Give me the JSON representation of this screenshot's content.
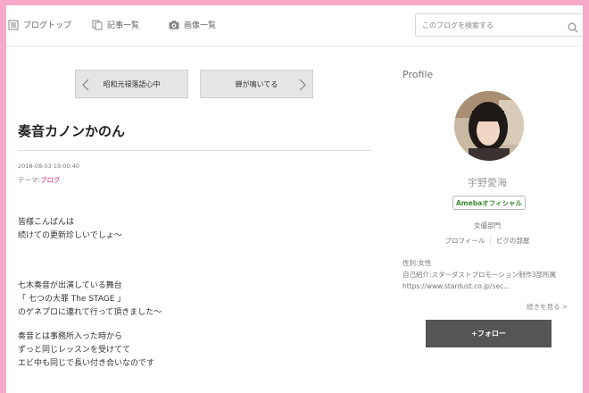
{
  "nav": {
    "items": [
      {
        "label": "ブログトップ",
        "icon": "list-icon"
      },
      {
        "label": "記事一覧",
        "icon": "copy-icon"
      },
      {
        "label": "画像一覧",
        "icon": "camera-icon"
      }
    ],
    "search_placeholder": "このブログを検索する"
  },
  "pager": {
    "prev_label": "昭和元禄落語心中",
    "next_label": "蝉が鳴いてる"
  },
  "article": {
    "title": "奏音カノンかのん",
    "date": "2018-08-03 19:00:40",
    "theme_prefix": "テーマ:",
    "theme_link": "ブログ",
    "paragraphs": [
      [
        "皆様こんばんは",
        "続けての更新珍しいでしょ〜"
      ],
      [
        "七木奏音が出演している舞台",
        "「 七つの大罪 The STAGE 」",
        "のゲネプロに連れて行って頂きました〜"
      ],
      [
        "奏音とは事務所入った時から",
        "ずっと同じレッスンを受けてて",
        "エビ中も同じで長い付き合いなのです"
      ]
    ]
  },
  "profile": {
    "heading": "Profile",
    "name": "宇野愛海",
    "official_badge": "Amebaオフィシャル",
    "category": "女優部門",
    "link_profile": "プロフィール",
    "link_room": "ピグの部屋",
    "gender": "性別:女性",
    "intro": "自己紹介:スターダストプロモーション制作3部所属",
    "url": "https://www.stardust.co.jp/sec...",
    "more": "続きを見る >",
    "follow": "+フォロー"
  },
  "colors": {
    "page_border": "#f7a9c9",
    "theme_link": "#d5297b",
    "official_badge": "#3b8a2f",
    "follow_button": "#555555"
  }
}
